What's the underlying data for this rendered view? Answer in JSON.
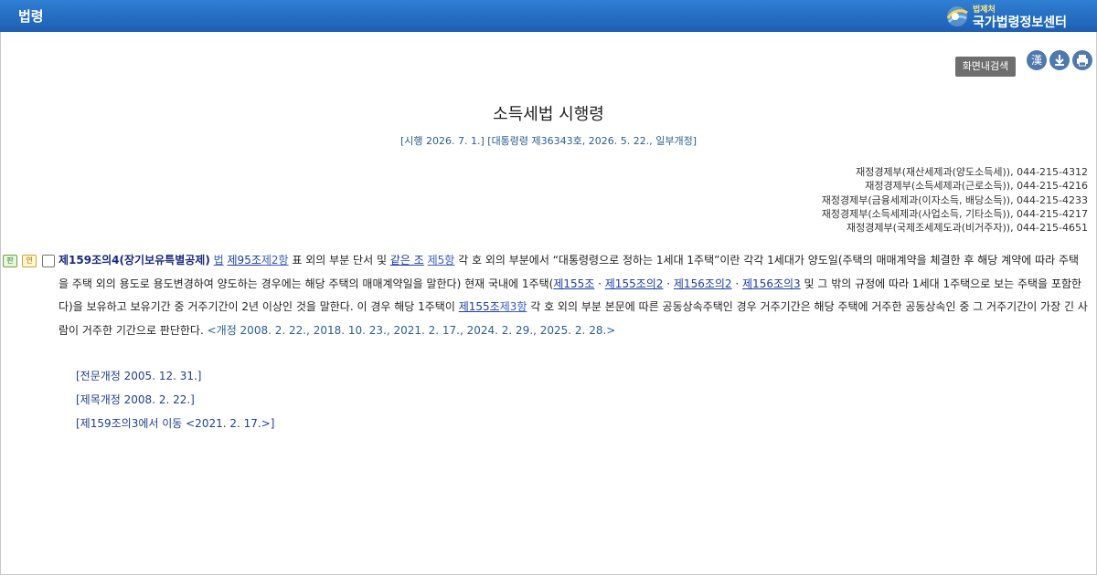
{
  "header": {
    "title": "법령",
    "brand_small": "법제처",
    "brand_big": "국가법령정보센터"
  },
  "toolbar": {
    "search_label": "화면내검색",
    "hanja_label": "漢",
    "download_icon": "download-icon",
    "print_icon": "print-icon"
  },
  "document": {
    "title": "소득세법 시행령",
    "subtitle": "[시행 2026. 7. 1.] [대통령령 제36343호, 2026. 5. 22., 일부개정]",
    "contacts": [
      "재정경제부(재산세제과(양도소득세)), 044-215-4312",
      "재정경제부(소득세제과(근로소득)), 044-215-4216",
      "재정경제부(금융세제과(이자소득, 배당소득)), 044-215-4233",
      "재정경제부(소득세제과(사업소득, 기타소득)), 044-215-4217",
      "재정경제부(국제조세제도과(비거주자)), 044-215-4651"
    ]
  },
  "article": {
    "tag_pan": "판",
    "tag_yeon": "연",
    "heading": "제159조의4(장기보유특별공제)",
    "link_law": "법",
    "link_art95": "제95조",
    "link_para2": "제2항",
    "t1": " 표 외의 부분 단서 및 ",
    "link_same_art": "같은 조",
    "link_para5": "제5항",
    "t2": " 각 호 외의 부분에서 “대통령령으로 정하는 1세대 1주택”이란 각각 1세대가 양도일(주택의 매매계약을 체결한 후 해당 계약에 따라 주택을 주택 외의 용도로 용도변경하여 양도하는 경우에는 해당 주택의 매매계약일을 말한다) 현재 국내에 1주택(",
    "link_155": "제155조",
    "sep1": " · ",
    "link_155_2": "제155조의2",
    "sep2": " · ",
    "link_156_2": "제156조의2",
    "sep3": " · ",
    "link_156_3": "제156조의3",
    "t3": " 및 그 밖의 규정에 따라 1세대 1주택으로 보는 주택을 포함한다)을 보유하고 보유기간 중 거주기간이 2년 이상인 것을 말한다. 이 경우 해당 1주택이 ",
    "link_155_b": "제155조",
    "link_para3": "제3항",
    "t4": " 각 호 외의 부분 본문에 따른 공동상속주택인 경우 거주기간은 해당 주택에 거주한 공동상속인 중 그 거주기간이 가장 긴 사람이 거주한 기간으로 판단한다.  ",
    "amend": "<개정 2008. 2. 22., 2018. 10. 23., 2021. 2. 17., 2024. 2. 29., 2025. 2. 28.>",
    "history": [
      "[전문개정 2005. 12. 31.]",
      "[제목개정 2008. 2. 22.]",
      "[제159조의3에서 이동 <2021. 2. 17.>]"
    ]
  }
}
